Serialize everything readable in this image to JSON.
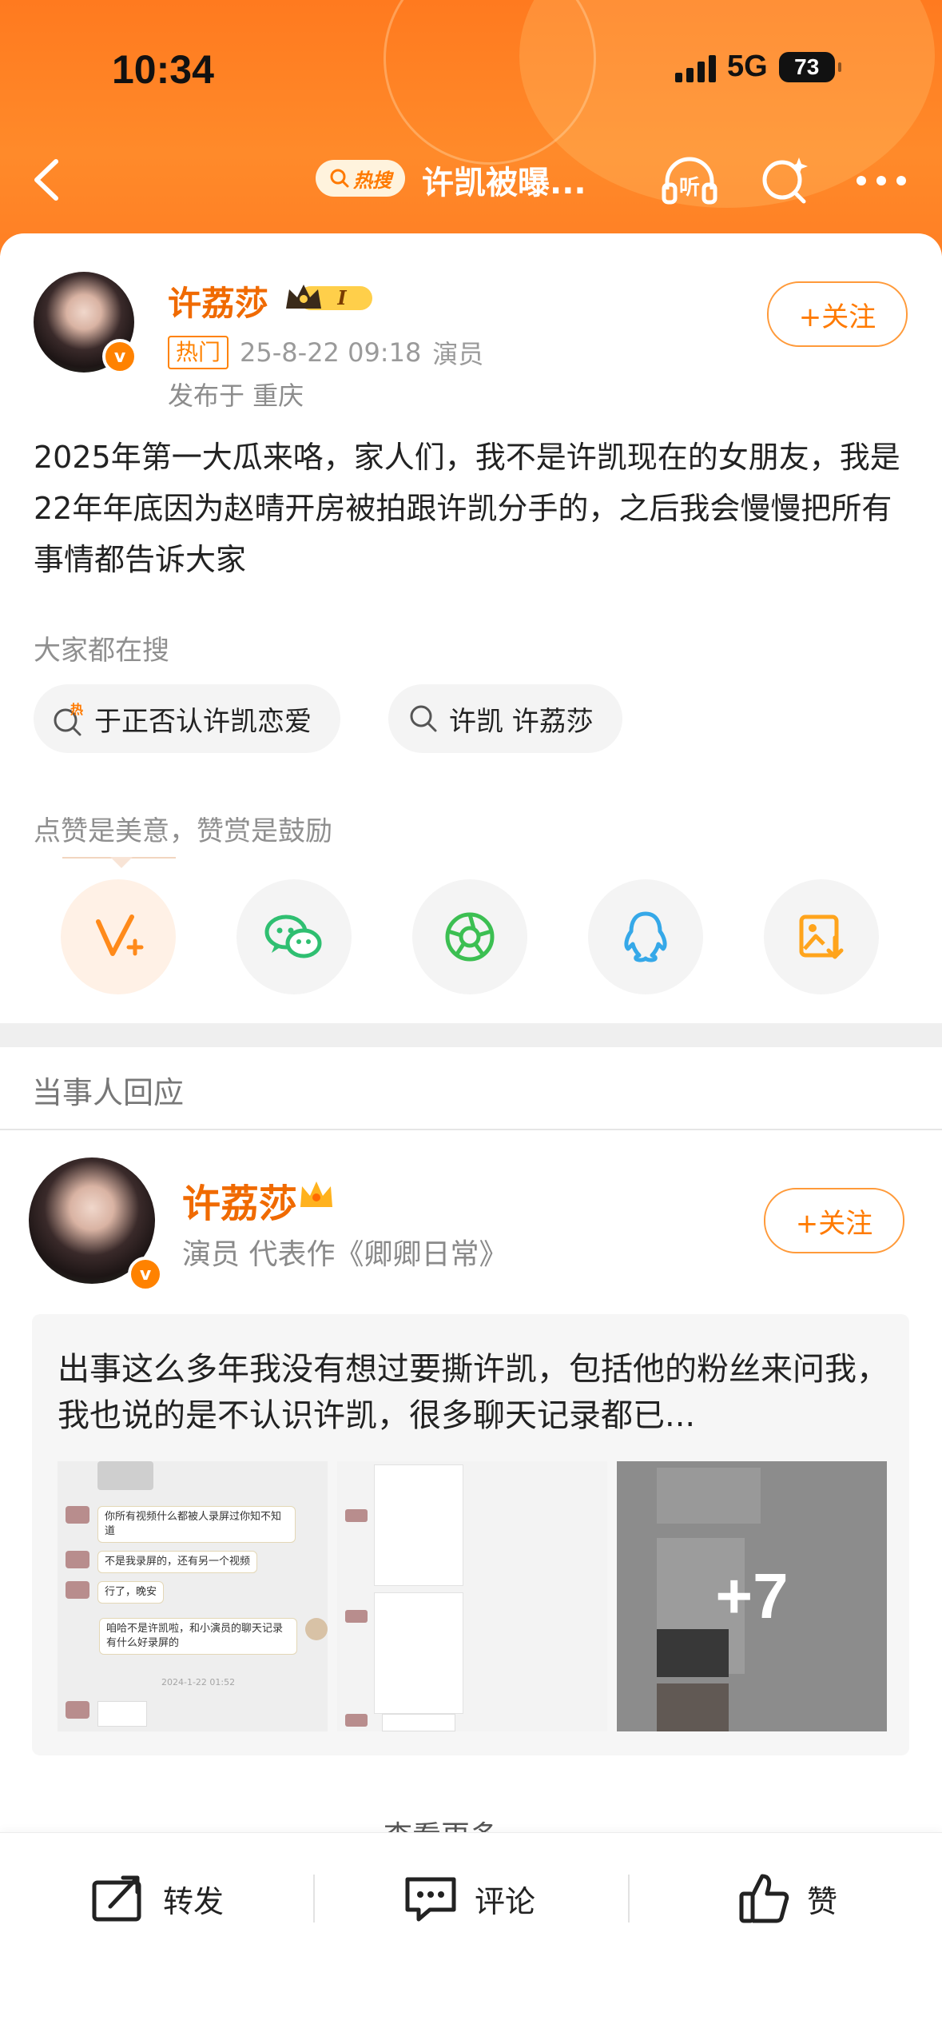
{
  "status_bar": {
    "time": "10:34",
    "network": "5G",
    "battery": "73"
  },
  "topbar": {
    "hot_badge": "热搜",
    "title": "许凯被曝..."
  },
  "post": {
    "author": "许荔莎",
    "level_badge": "I",
    "verified_mark": "v",
    "hot_tag": "热门",
    "timestamp": "25-8-22 09:18",
    "role": "演员",
    "location": "发布于 重庆",
    "follow_label": "+关注",
    "text": "2025年第一大瓜来咯，家人们，我不是许凯现在的女朋友，我是22年年底因为赵晴开房被拍跟许凯分手的，之后我会慢慢把所有事情都告诉大家"
  },
  "search": {
    "label": "大家都在搜",
    "chips": [
      {
        "label": "于正否认许凯恋爱",
        "icon": "hot-search-icon"
      },
      {
        "label": "许凯 许荔莎",
        "icon": "search-icon"
      }
    ]
  },
  "encourage": {
    "label": "点赞是美意，赞赏是鼓励"
  },
  "share_targets": [
    "weibo-reward-icon",
    "wechat-icon",
    "moments-icon",
    "qq-icon",
    "save-image-icon"
  ],
  "response": {
    "section_label": "当事人回应",
    "author": "许荔莎",
    "meta": "演员 代表作《卿卿日常》",
    "follow_label": "+关注",
    "quote": "出事这么多年我没有想过要撕许凯，包括他的粉丝来问我，我也说的是不认识许凯，很多聊天记录都已...",
    "chat_lines": [
      "你所有视频什么都被人录屏过你知不知道",
      "不是我录屏的，还有另一个视频",
      "行了，晚安",
      "咱哈不是许凯啦，和小演员的聊天记录有什么好录屏的"
    ],
    "chat_time": "2024-1-22 01:52",
    "more_images": "+7",
    "see_more": "查看更多"
  },
  "bottom_bar": {
    "repost": "转发",
    "comment": "评论",
    "like": "赞"
  },
  "colors": {
    "brand_orange": "#ff8200",
    "name_orange": "#f06a00",
    "wechat_green": "#2fbf71",
    "qq_blue": "#35a8e8"
  }
}
